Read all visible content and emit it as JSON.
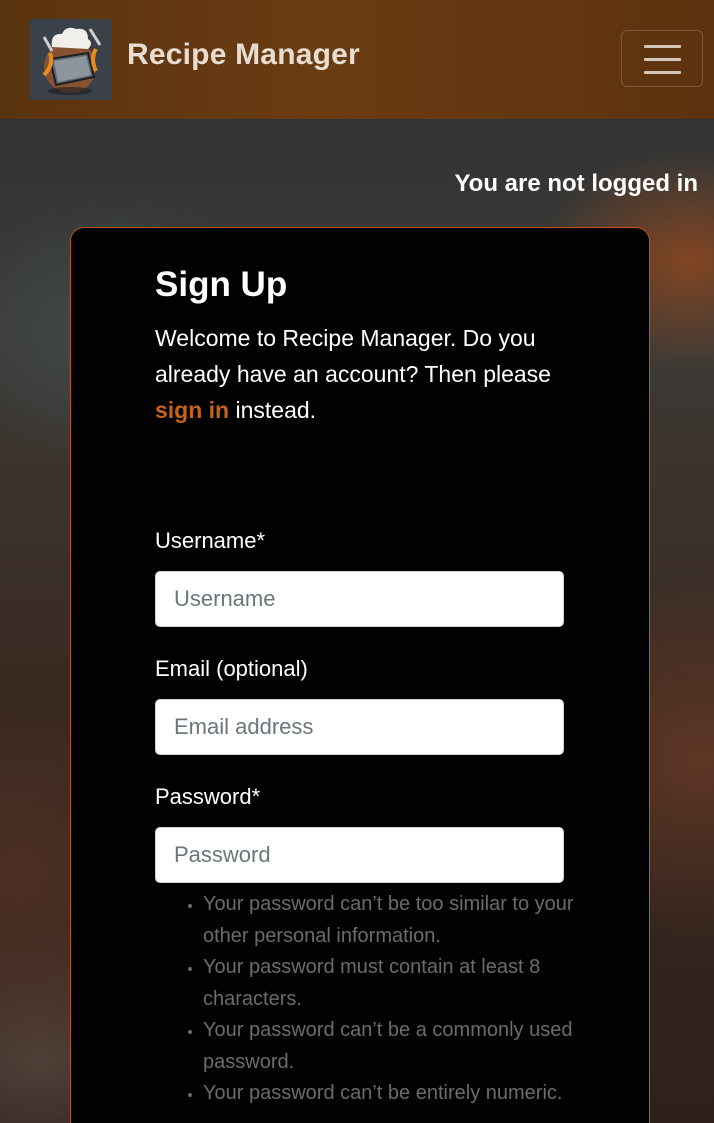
{
  "navbar": {
    "logo_alt": "Recipe Manager logo",
    "brand": "Recipe Manager",
    "toggler_icon": "hamburger-menu-icon"
  },
  "auth_status": "You are not logged in",
  "form": {
    "title": "Sign Up",
    "intro": {
      "text_1": "Welcome to ",
      "brand": "Recipe Manager",
      "text_2": ". Do you already have an account? Then please ",
      "link": "sign in",
      "text_3": " instead."
    },
    "fields": [
      {
        "label": "Username*",
        "placeholder": "Username",
        "value": ""
      },
      {
        "label": "Email (optional)",
        "placeholder": "Email address",
        "value": ""
      },
      {
        "label": "Password*",
        "placeholder": "Password",
        "value": ""
      }
    ],
    "password_help": [
      "Your password can’t be too similar to your other personal information.",
      "Your password must contain at least 8 characters.",
      "Your password can’t be a commonly used password.",
      "Your password can’t be entirely numeric."
    ]
  },
  "colors": {
    "navbar": "#6a3c12",
    "accent": "#c4621e",
    "card_border": "#b5561c",
    "card_bg": "#020202",
    "help_text": "#6b6b6b"
  }
}
